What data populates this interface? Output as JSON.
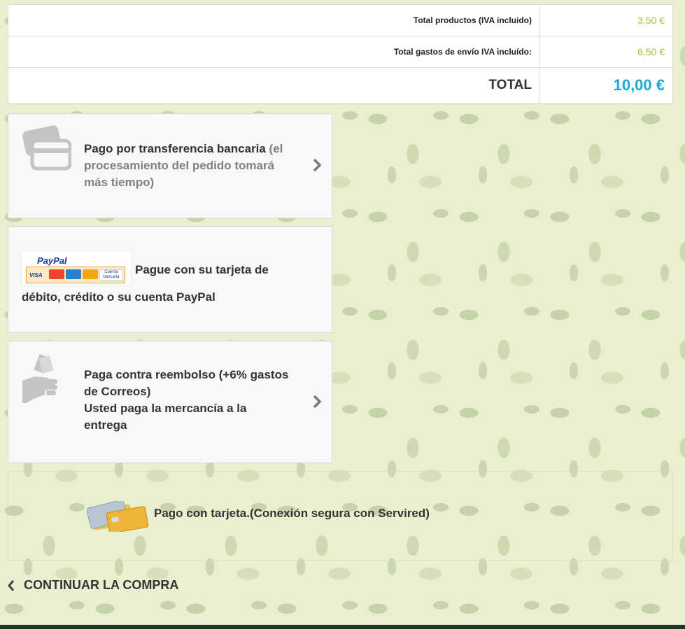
{
  "totals": {
    "products_label": "Total productos (IVA incluido)",
    "products_value": "3,50 €",
    "shipping_label": "Total gastos de envío IVA incluído:",
    "shipping_value": "6,50 €",
    "total_label": "TOTAL",
    "total_value": "10,00 €"
  },
  "payment_options": {
    "bank_transfer": {
      "title": "Pago por transferencia bancaria",
      "note_line1": " (el",
      "note_line2": "procesamiento del pedido tomará",
      "note_line3": "más tiempo)",
      "icon": "credit-card-icon"
    },
    "paypal": {
      "logo_text": "PayPal",
      "logo_visa": "VISA",
      "logo_account": "Cuenta bancaria",
      "line1": "Pague con su tarjeta de",
      "line2": "débito, crédito o su cuenta PayPal"
    },
    "cash_on_delivery": {
      "line1": "Paga contra reembolso (+6% gastos",
      "line2": "de Correos)",
      "line3": "Usted paga la mercancía a la",
      "line4": "entrega",
      "icon": "cash-hand-icon"
    },
    "card": {
      "label": "Pago con tarjeta.(Conexión segura con Servired)",
      "icon": "credit-cards-icon"
    }
  },
  "continue_shopping": {
    "label": "CONTINUAR LA COMPRA",
    "icon": "chevron-left-icon"
  },
  "colors": {
    "price": "#a8bf3e",
    "total": "#1da8d6",
    "footer": "#1d3524"
  }
}
